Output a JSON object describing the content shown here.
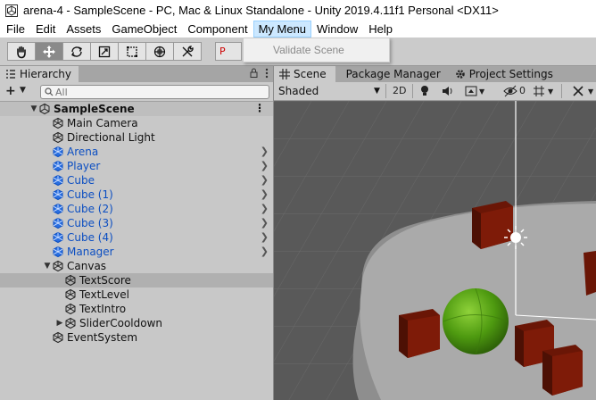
{
  "window": {
    "title": "arena-4 - SampleScene - PC, Mac & Linux Standalone - Unity 2019.4.11f1 Personal <DX11>"
  },
  "menubar": {
    "items": [
      "File",
      "Edit",
      "Assets",
      "GameObject",
      "Component",
      "My Menu",
      "Window",
      "Help"
    ],
    "open_item": "My Menu"
  },
  "dropdown": {
    "items": [
      {
        "label": "Validate Scene",
        "disabled": true
      }
    ]
  },
  "toolbar": {
    "tools": [
      "hand-tool",
      "move-tool",
      "rotate-tool",
      "scale-tool",
      "rect-tool",
      "transform-tool",
      "custom-tool"
    ],
    "active_tool": "move-tool",
    "pivot_label": "P"
  },
  "hierarchy": {
    "tab_label": "Hierarchy",
    "add_label": "+",
    "search_placeholder": "All",
    "scene_name": "SampleScene",
    "rows": [
      {
        "label": "Main Camera",
        "indent": 1,
        "prefab": false,
        "arrow": false,
        "fold": ""
      },
      {
        "label": "Directional Light",
        "indent": 1,
        "prefab": false,
        "arrow": false,
        "fold": ""
      },
      {
        "label": "Arena",
        "indent": 1,
        "prefab": true,
        "arrow": true,
        "fold": ""
      },
      {
        "label": "Player",
        "indent": 1,
        "prefab": true,
        "arrow": true,
        "fold": ""
      },
      {
        "label": "Cube",
        "indent": 1,
        "prefab": true,
        "arrow": true,
        "fold": ""
      },
      {
        "label": "Cube (1)",
        "indent": 1,
        "prefab": true,
        "arrow": true,
        "fold": ""
      },
      {
        "label": "Cube (2)",
        "indent": 1,
        "prefab": true,
        "arrow": true,
        "fold": ""
      },
      {
        "label": "Cube (3)",
        "indent": 1,
        "prefab": true,
        "arrow": true,
        "fold": ""
      },
      {
        "label": "Cube (4)",
        "indent": 1,
        "prefab": true,
        "arrow": true,
        "fold": ""
      },
      {
        "label": "Manager",
        "indent": 1,
        "prefab": true,
        "arrow": true,
        "fold": ""
      },
      {
        "label": "Canvas",
        "indent": 1,
        "prefab": false,
        "arrow": false,
        "fold": "open"
      },
      {
        "label": "TextScore",
        "indent": 2,
        "prefab": false,
        "arrow": false,
        "fold": "",
        "selected": true
      },
      {
        "label": "TextLevel",
        "indent": 2,
        "prefab": false,
        "arrow": false,
        "fold": ""
      },
      {
        "label": "TextIntro",
        "indent": 2,
        "prefab": false,
        "arrow": false,
        "fold": ""
      },
      {
        "label": "SliderCooldown",
        "indent": 2,
        "prefab": false,
        "arrow": false,
        "fold": "closed"
      },
      {
        "label": "EventSystem",
        "indent": 1,
        "prefab": false,
        "arrow": false,
        "fold": ""
      }
    ]
  },
  "scene_panel": {
    "tabs": [
      {
        "label": "Scene",
        "active": true,
        "icon": "grid-icon"
      },
      {
        "label": "Package Manager",
        "active": false,
        "icon": ""
      },
      {
        "label": "Project Settings",
        "active": false,
        "icon": "gear-icon"
      }
    ],
    "shading_mode": "Shaded",
    "mode_2d": "2D",
    "hidden_count": "0"
  },
  "colors": {
    "prefab_blue": "#0b4ec2",
    "cube_red": "#7a1a08",
    "sphere_green": "#4e9a10",
    "arena_gray": "#aaaaaa"
  }
}
